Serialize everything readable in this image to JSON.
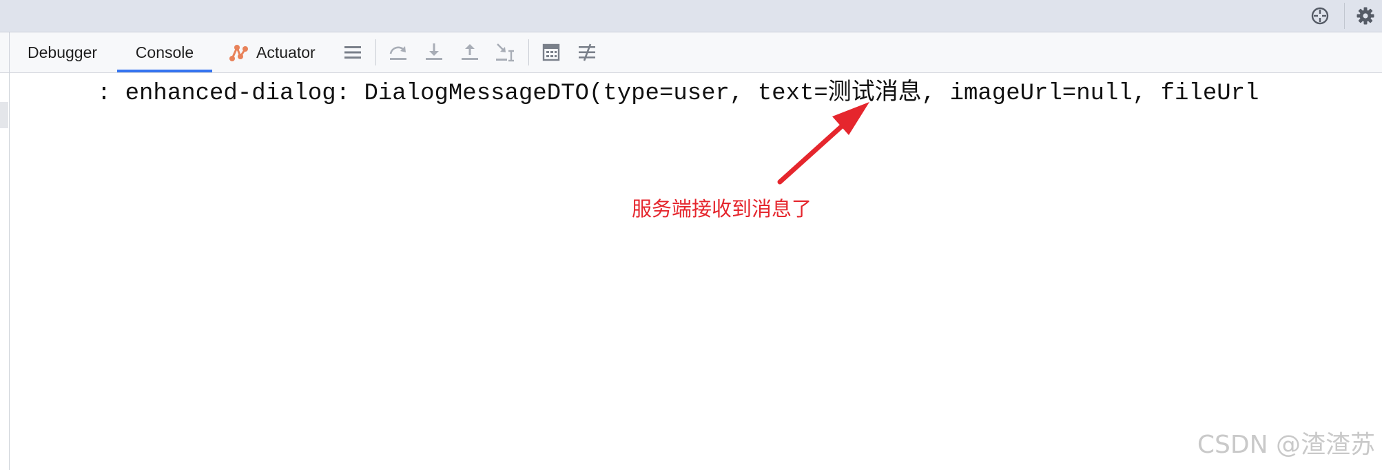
{
  "toolbar_top": {
    "icons": [
      "crosshair-icon",
      "gear-icon"
    ]
  },
  "tabs": [
    {
      "label": "Debugger",
      "active": false
    },
    {
      "label": "Console",
      "active": true
    },
    {
      "label": "Actuator",
      "active": false,
      "icon": "actuator-icon"
    }
  ],
  "debug_toolbar": {
    "icons": [
      "list-menu-icon",
      "step-over-icon",
      "step-into-icon",
      "step-out-icon",
      "run-to-cursor-icon",
      "evaluate-expression-icon",
      "trace-settings-icon"
    ]
  },
  "console": {
    "log_line": "  : enhanced-dialog: DialogMessageDTO(type=user, text=测试消息, imageUrl=null, fileUrl"
  },
  "annotation": {
    "text": "服务端接收到消息了",
    "color": "#e5262d"
  },
  "watermark": "CSDN @渣渣苏",
  "colors": {
    "accent": "#3574f0",
    "actuator": "#e8825a"
  }
}
